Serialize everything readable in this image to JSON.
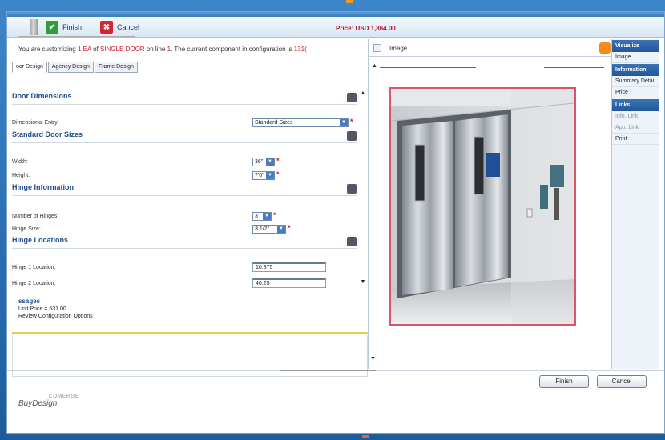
{
  "toolbar": {
    "finish_label": "Finish",
    "cancel_label": "Cancel",
    "price_text": "Price: USD 1,864.00"
  },
  "message": {
    "prefix": "You are customizing ",
    "qty": "1 EA",
    "mid1": " of ",
    "product": "SINGLE DOOR",
    "mid2": " on line ",
    "line_no": "1",
    "suffix": ". The current component in configuration is ",
    "component": "131("
  },
  "tabs": [
    {
      "label": "oor Design"
    },
    {
      "label": "Agency Design"
    },
    {
      "label": "Frame Design"
    }
  ],
  "form": {
    "door_dimensions": "Door Dimensions",
    "dimensional_entry_label": "Dimensional Entry:",
    "dimensional_entry_value": "Standard Sizes",
    "standard_door_sizes": "Standard Door Sizes",
    "width_label": "Width:",
    "width_value": "36\"",
    "height_label": "Height:",
    "height_value": "7'0\"",
    "hinge_information": "Hinge Information",
    "number_hinges_label": "Number of Hinges:",
    "number_hinges_value": "3",
    "hinge_size_label": "Hinge Size:",
    "hinge_size_value": "3 1/2\"",
    "hinge_locations": "Hinge Locations",
    "hinge1_label": "Hinge 1 Location:",
    "hinge1_value": "10.375",
    "hinge2_label": "Hinge 2 Location:",
    "hinge2_value": "40.25"
  },
  "messages": {
    "title": "ssages",
    "line1": "Unit Price = 531.00",
    "line2": "Review Configuration Options"
  },
  "image_panel": {
    "title": "Image"
  },
  "right_nav": {
    "visualize_header": "Visualize",
    "image_item": "Image",
    "information_header": "Information",
    "summary_item": "Summary Detai",
    "price_item": "Price",
    "links_header": "Links",
    "info_link": "Info. Link",
    "app_link": "App. Link",
    "print_item": "Print"
  },
  "buttons": {
    "finish": "Finish",
    "cancel": "Cancel"
  },
  "logo": {
    "brand": "BuyDesign",
    "small": "COMERGE"
  },
  "colors": {
    "accent_blue": "#1f4e8a",
    "required_red": "#d01818",
    "price_red": "#b0102a",
    "photo_border": "#e0526b"
  }
}
